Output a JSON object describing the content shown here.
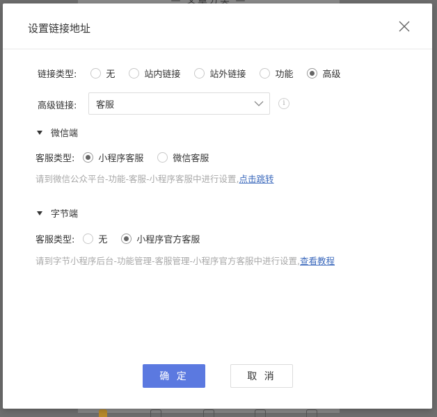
{
  "background": {
    "title": "— 文章分类 —"
  },
  "dialog": {
    "title": "设置链接地址",
    "link_type": {
      "label": "链接类型:",
      "options": [
        "无",
        "站内链接",
        "站外链接",
        "功能",
        "高级"
      ],
      "selected": "高级"
    },
    "advanced_link": {
      "label": "高级链接:",
      "value": "客服",
      "info_glyph": "i"
    },
    "wechat": {
      "section_title": "微信端",
      "service_type_label": "客服类型:",
      "options": [
        "小程序客服",
        "微信客服"
      ],
      "selected": "小程序客服",
      "hint": "请到微信公众平台-功能-客服-小程序客服中进行设置,",
      "hint_link": "点击跳转"
    },
    "bytedance": {
      "section_title": "字节端",
      "service_type_label": "客服类型:",
      "options": [
        "无",
        "小程序官方客服"
      ],
      "selected": "小程序官方客服",
      "hint": "请到字节小程序后台-功能管理-客服管理-小程序官方客服中进行设置,",
      "hint_link": "查看教程"
    },
    "buttons": {
      "ok": "确 定",
      "cancel": "取 消"
    },
    "colors": {
      "primary": "#5b79e0",
      "link": "#3e6bbd",
      "hint": "#a8a8a8"
    }
  }
}
